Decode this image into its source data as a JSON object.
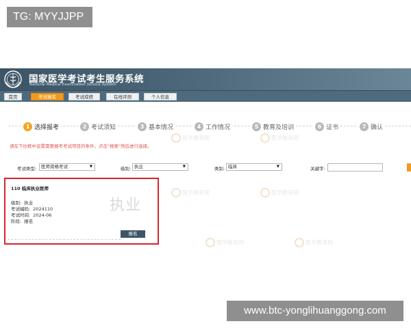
{
  "overlay_tag": "TG: MYYJJPP",
  "header": {
    "title_cn": "国家医学考试考生服务系统",
    "title_en": "National Medical Examination Service System"
  },
  "nav": {
    "items": [
      {
        "label": "首页",
        "active": false
      },
      {
        "label": "考试报名",
        "active": true
      },
      {
        "label": "考试成绩",
        "active": false
      },
      {
        "label": "在线评测",
        "active": false
      },
      {
        "label": "个人信息",
        "active": false
      }
    ]
  },
  "steps": [
    {
      "num": "1",
      "label": "选择报考",
      "active": true
    },
    {
      "num": "2",
      "label": "考试须知",
      "active": false
    },
    {
      "num": "3",
      "label": "基本情况",
      "active": false
    },
    {
      "num": "4",
      "label": "工作情况",
      "active": false
    },
    {
      "num": "5",
      "label": "教育及培训",
      "active": false
    },
    {
      "num": "6",
      "label": "证书",
      "active": false
    },
    {
      "num": "7",
      "label": "确认",
      "active": false
    }
  ],
  "instruction": "请在下拉框中设置需要报考考试项目的条件，点击\"搜索\"然后进行选择。",
  "filters": {
    "exam_type_label": "考试类型:",
    "exam_type_value": "医师资格考试",
    "level_label": "级别:",
    "level_value": "执业",
    "category_label": "类别:",
    "category_value": "临床",
    "keyword_label": "关键字:",
    "keyword_value": ""
  },
  "card": {
    "title": "110 临床执业医师",
    "stamp": "执业",
    "rows": [
      {
        "key": "级别:",
        "value": "执业"
      },
      {
        "key": "考试编码:",
        "value": "2024110"
      },
      {
        "key": "考试时间:",
        "value": "2024-06"
      },
      {
        "key": "阶段:",
        "value": "报名"
      }
    ],
    "apply_label": "报名"
  },
  "watermark_text": "医学教育网",
  "url_overlay": "www.btc-yonglihuanggong.com",
  "colors": {
    "accent_orange": "#f29a1e",
    "header_bg": "#4a6577",
    "highlight_red": "#d8232a",
    "instruction_red": "#e0554f"
  }
}
